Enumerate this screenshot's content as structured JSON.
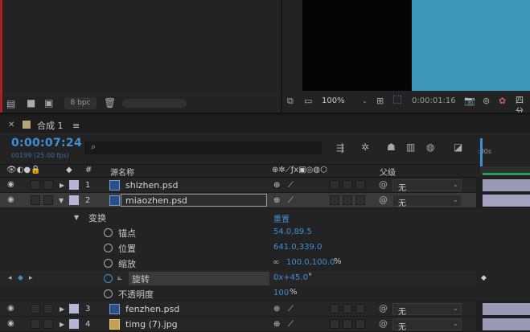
{
  "project": {
    "bpc": "8 bpc",
    "icons": [
      "interpret-footage-icon",
      "folder-icon",
      "composition-icon",
      "trash-icon"
    ]
  },
  "viewer": {
    "zoom": "100%",
    "timecode": "0:00:01:16",
    "resolution": "四分"
  },
  "timeline": {
    "tab_label": "合成 1",
    "menu_glyph": "≡",
    "current_time": "0:00:07:24",
    "frames_info": "00199 (25.00 fps)",
    "search_placeholder": "",
    "ruler_start": ":00s",
    "columns": {
      "source_name": "源名称",
      "index": "#",
      "parent": "父级"
    },
    "layers": [
      {
        "index": "1",
        "name": "shizhen.psd",
        "parent": "无",
        "type": "psd"
      },
      {
        "index": "2",
        "name": "miaozhen.psd",
        "parent": "无",
        "type": "psd",
        "selected": true
      },
      {
        "index": "3",
        "name": "fenzhen.psd",
        "parent": "无",
        "type": "psd"
      },
      {
        "index": "4",
        "name": "timg (7).jpg",
        "parent": "无",
        "type": "jpg"
      }
    ],
    "transform": {
      "label": "变换",
      "reset": "重置",
      "properties": [
        {
          "name": "锚点",
          "value": "54.0,89.5"
        },
        {
          "name": "位置",
          "value": "641.0,339.0"
        },
        {
          "name": "缩放",
          "value": "100.0,100.0",
          "unit": "%"
        },
        {
          "name": "旋转",
          "value": "0x+45.0",
          "unit": "°"
        },
        {
          "name": "不透明度",
          "value": "100",
          "unit": "%"
        }
      ]
    }
  },
  "colors": {
    "accent": "#3f8fd4",
    "viewer_blue": "#3d97b8",
    "label_lavender": "#b6b5d8"
  }
}
